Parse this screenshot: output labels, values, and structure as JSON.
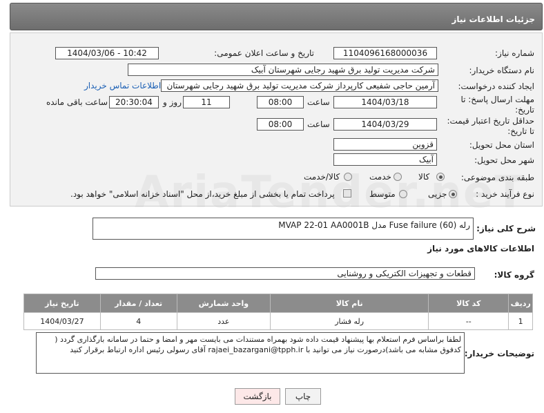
{
  "header": {
    "title": "جزئیات اطلاعات نیاز"
  },
  "fields": {
    "need_number_label": "شماره نیاز:",
    "need_number": "1104096168000036",
    "announce_label": "تاریخ و ساعت اعلان عمومی:",
    "announce_value": "1404/03/06 - 10:42",
    "buyer_org_label": "نام دستگاه خریدار:",
    "buyer_org": "شرکت مدیریت تولید برق شهید رجایی شهرستان آبیک",
    "requester_label": "ایجاد کننده درخواست:",
    "requester": "آرمین حاجی شفیعی کارپرداز شرکت مدیریت تولید برق شهید رجایی شهرستان",
    "contact_link": "اطلاعات تماس خریدار",
    "deadline_label_1": "مهلت ارسال پاسخ: تا",
    "deadline_label_2": "تاریخ:",
    "deadline_date": "1404/03/18",
    "hour_label": "ساعت",
    "deadline_time": "08:00",
    "days_value": "11",
    "days_label": "روز و",
    "remaining_time": "20:30:04",
    "remaining_label": "ساعت باقی مانده",
    "validity_label_1": "حداقل تاریخ اعتبار قیمت:",
    "validity_label_2": "تا تاریخ:",
    "validity_date": "1404/03/29",
    "validity_hour_label": "ساعت",
    "validity_time": "08:00",
    "province_label": "استان محل تحویل:",
    "province": "قزوین",
    "city_label": "شهر محل تحویل:",
    "city": "آبیک",
    "category_label": "طبقه بندی موضوعی:",
    "category_options": [
      "کالا",
      "خدمت",
      "کالا/خدمت"
    ],
    "category_selected": "کالا",
    "process_label": "نوع فرآیند خرید :",
    "process_options": [
      "جزیی",
      "متوسط"
    ],
    "process_selected": "جزیی",
    "payment_note": "پرداخت تمام یا بخشی از مبلغ خرید،از محل \"اسناد خزانه اسلامی\" خواهد بود."
  },
  "description": {
    "label": "شرح کلی نیاز:",
    "value": "رله (60) Fuse failure مدل MVAP 22-01 AA0001B"
  },
  "goods": {
    "section_title": "اطلاعات کالاهای مورد نیاز",
    "group_label": "گروه کالا:",
    "group_value": "قطعات و تجهیزات الکتریکی و روشنایی",
    "columns": [
      "ردیف",
      "کد کالا",
      "نام کالا",
      "واحد شمارش",
      "تعداد / مقدار",
      "تاریخ نیاز"
    ],
    "rows": [
      {
        "row": "1",
        "code": "--",
        "name": "رله فشار",
        "unit": "عدد",
        "qty": "4",
        "date": "1404/03/27"
      }
    ]
  },
  "buyer_notes": {
    "label": "توضیحات خریدار:",
    "text": "لطفا براساس فرم استعلام بها پیشنهاد قیمت داده شود بهمراه مستندات می بایست مهر و امضا و حتما در سامانه بارگذاری گردد ( کدفوق مشابه می باشد)درصورت نیاز می توانید با rajaei_bazargani@tpph.ir آقای رسولی رئیس  اداره ارتباط برقرار کنید"
  },
  "buttons": {
    "print": "چاپ",
    "back": "بازگشت"
  },
  "watermark": "AriaTender.neT"
}
